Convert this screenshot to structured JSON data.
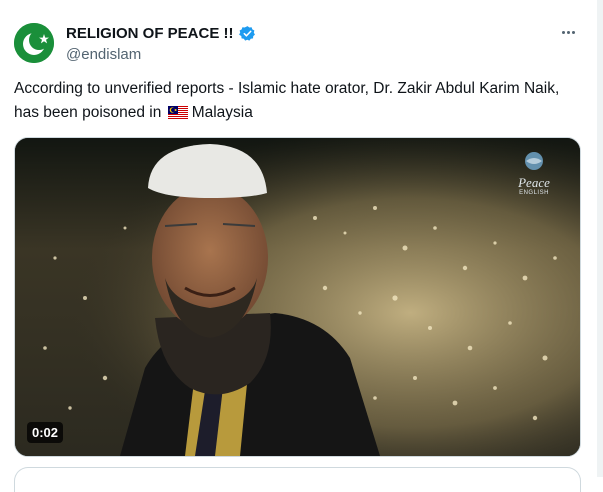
{
  "tweet": {
    "display_name": "RELIGION OF PEACE !!",
    "handle": "@endislam",
    "text_part1": "According to unverified reports - Islamic hate orator, Dr. Zakir Abdul Karim Naik, has been poisoned in",
    "flag_icon": "malaysia-flag-icon",
    "text_part2": "Malaysia",
    "verified_icon": "verified-badge-icon",
    "more_icon": "more-options-icon"
  },
  "media": {
    "duration": "0:02",
    "watermark_main": "Peace",
    "watermark_sub": "ENGLISH"
  },
  "colors": {
    "text": "#0f1419",
    "secondary": "#536471",
    "verified": "#1d9bf0",
    "avatar_green": "#1a8f3a",
    "border": "#cfd9de"
  }
}
